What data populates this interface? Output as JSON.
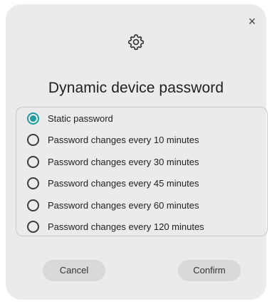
{
  "dialog": {
    "close_glyph": "×",
    "icon": "gear-icon",
    "title": "Dynamic device password",
    "selected_index": 0,
    "options": [
      {
        "label": "Static password",
        "checked": true
      },
      {
        "label": "Password changes every 10 minutes",
        "checked": false
      },
      {
        "label": "Password changes every 30 minutes",
        "checked": false
      },
      {
        "label": "Password changes every 45 minutes",
        "checked": false
      },
      {
        "label": "Password changes every 60 minutes",
        "checked": false
      },
      {
        "label": "Password changes every 120 minutes",
        "checked": false
      }
    ],
    "cancel_label": "Cancel",
    "confirm_label": "Confirm"
  },
  "colors": {
    "accent": "#1f9c9c",
    "dialog_bg": "#ebebeb",
    "button_bg": "#d9d9d9"
  }
}
